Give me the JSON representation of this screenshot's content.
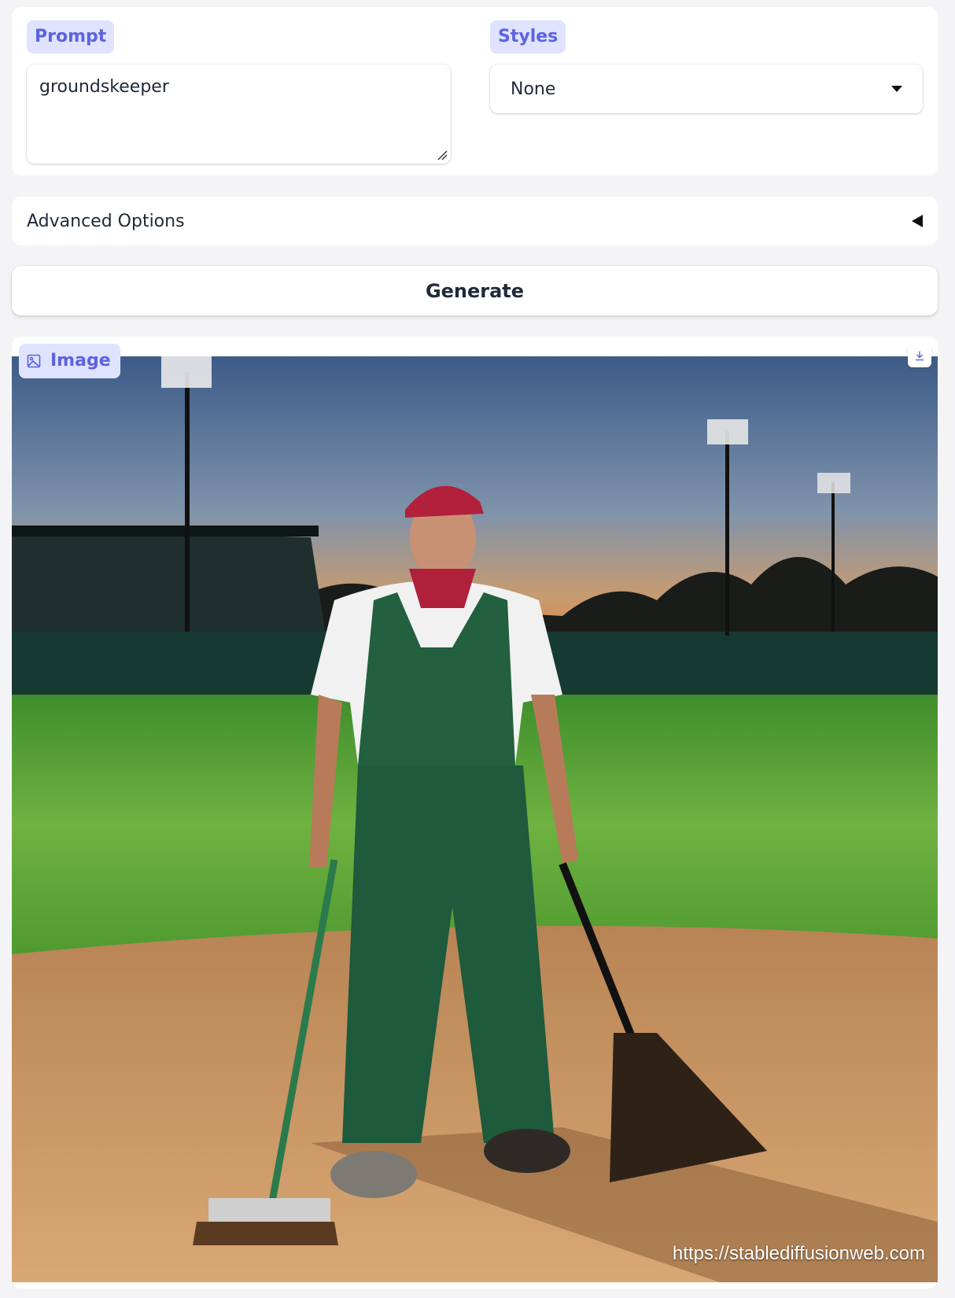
{
  "prompt": {
    "label": "Prompt",
    "value": "groundskeeper"
  },
  "styles": {
    "label": "Styles",
    "selected": "None"
  },
  "advanced": {
    "label": "Advanced Options"
  },
  "generate": {
    "label": "Generate"
  },
  "output": {
    "label": "Image",
    "watermark": "https://stablediffusionweb.com"
  },
  "colors": {
    "accent_chip_bg": "#dfe3ff",
    "accent_chip_text": "#5c63e0"
  }
}
